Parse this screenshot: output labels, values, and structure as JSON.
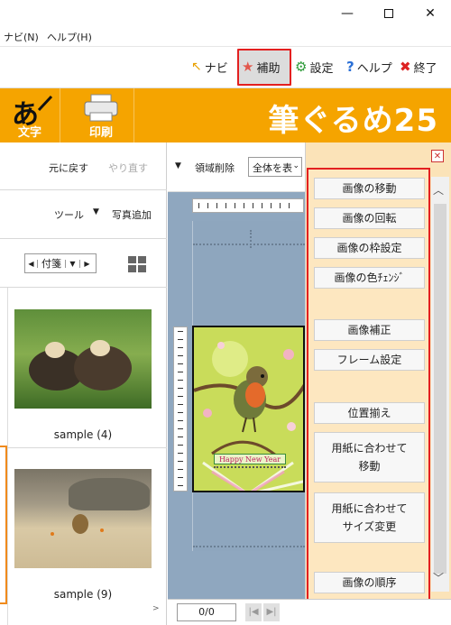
{
  "menubar": {
    "navi": "ナビ(N)",
    "help": "ヘルプ(H)"
  },
  "toolbar": {
    "navi": "ナビ",
    "hojo": "補助",
    "settings": "設定",
    "help": "ヘルプ",
    "exit": "終了"
  },
  "ribbon": {
    "moji": "文字",
    "insatsu": "印刷",
    "logo": "筆ぐるめ25",
    "moji_glyph": "あ"
  },
  "left": {
    "undo": "元に戻す",
    "redo": "やり直す",
    "tool": "ツール",
    "add_photo": "写真追加",
    "sticky": "付箋",
    "thumbs": [
      {
        "caption": "sample (4)"
      },
      {
        "caption": "sample (9)"
      }
    ]
  },
  "center": {
    "area_delete": "領域削除",
    "select_all": "全体を表",
    "card_text": "Happy New Year",
    "page_indicator": "0/0"
  },
  "actions": [
    "画像の移動",
    "画像の回転",
    "画像の枠設定",
    "画像の色ﾁｪﾝｼﾞ",
    "画像補正",
    "フレーム設定",
    "位置揃え",
    "用紙に合わせて\n移動",
    "用紙に合わせて\nサイズ変更",
    "画像の順序"
  ],
  "colors": {
    "accent_red": "#e32020",
    "ribbon_orange": "#f5a400",
    "panel_cream": "#fde7c0"
  }
}
